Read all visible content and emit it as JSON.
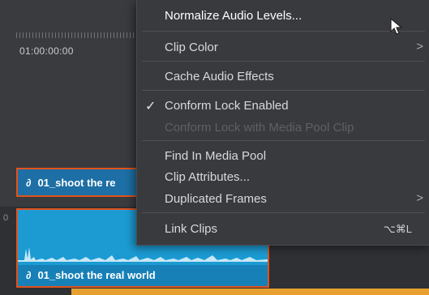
{
  "timeline": {
    "timecode": "01:00:00:00",
    "track_number": "0",
    "video_clip": {
      "icon": "link-icon",
      "label": "01_shoot the re"
    },
    "audio_clip": {
      "icon": "link-icon",
      "label": "01_shoot the real world"
    }
  },
  "context_menu": {
    "items": [
      {
        "label": "Normalize Audio Levels...",
        "highlight": true
      },
      {
        "label": "Clip Color",
        "submenu": true
      },
      {
        "label": "Cache Audio Effects"
      },
      {
        "label": "Conform Lock Enabled",
        "checked": true,
        "check": "✓"
      },
      {
        "label": "Conform Lock with Media Pool Clip",
        "disabled": true
      },
      {
        "label": "Find In Media Pool"
      },
      {
        "label": "Clip Attributes..."
      },
      {
        "label": "Duplicated Frames",
        "submenu": true
      },
      {
        "label": "Link Clips",
        "shortcut": "⌥⌘L"
      }
    ],
    "submenu_glyph": ">"
  },
  "colors": {
    "clip_blue": "#1c9bd3",
    "selection_border": "#e0531d",
    "menu_bg": "#393a3e"
  }
}
